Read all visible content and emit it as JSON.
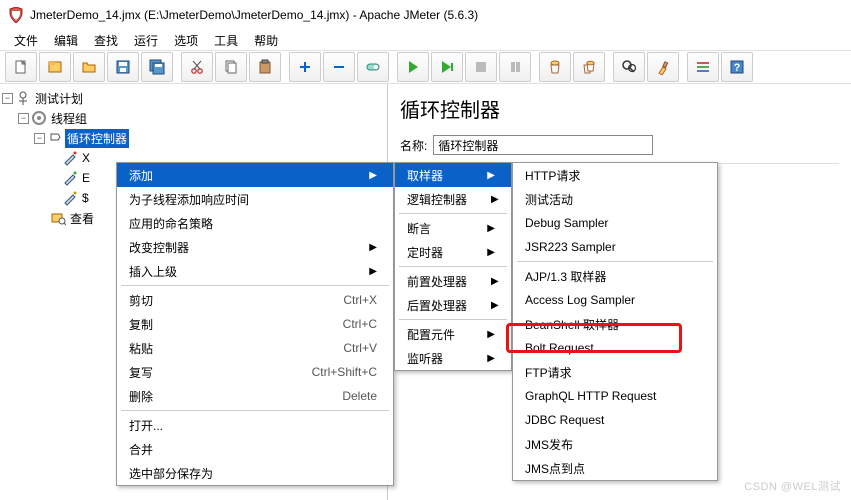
{
  "window": {
    "title": "JmeterDemo_14.jmx (E:\\JmeterDemo\\JmeterDemo_14.jmx) - Apache JMeter (5.6.3)"
  },
  "menubar": [
    "文件",
    "编辑",
    "查找",
    "运行",
    "选项",
    "工具",
    "帮助"
  ],
  "tree": {
    "root": "测试计划",
    "thread_group": "线程组",
    "loop_ctrl": "循环控制器",
    "child_prefix_1": "X",
    "child_prefix_2": "E",
    "child_prefix_3": "$",
    "view_results": "查看"
  },
  "panel": {
    "title": "循环控制器",
    "name_label": "名称:",
    "name_value": "循环控制器"
  },
  "menu1": {
    "add": "添加",
    "thread_response_time": "为子线程添加响应时间",
    "naming_policy": "应用的命名策略",
    "change_controller": "改变控制器",
    "insert_parent": "插入上级",
    "cut": "剪切",
    "cut_sc": "Ctrl+X",
    "copy": "复制",
    "copy_sc": "Ctrl+C",
    "paste": "粘贴",
    "paste_sc": "Ctrl+V",
    "duplicate": "复写",
    "duplicate_sc": "Ctrl+Shift+C",
    "delete": "删除",
    "delete_sc": "Delete",
    "open": "打开...",
    "merge": "合并",
    "save_selection": "选中部分保存为"
  },
  "menu2": {
    "sampler": "取样器",
    "logic": "逻辑控制器",
    "assertion": "断言",
    "timer": "定时器",
    "preproc": "前置处理器",
    "postproc": "后置处理器",
    "config": "配置元件",
    "listener": "监听器"
  },
  "menu3": {
    "http_request": "HTTP请求",
    "test_action": "测试活动",
    "debug_sampler": "Debug Sampler",
    "jsr223": "JSR223 Sampler",
    "ajp": "AJP/1.3 取样器",
    "access_log": "Access Log Sampler",
    "beanshell": "BeanShell 取样器",
    "bolt": "Bolt Request",
    "ftp": "FTP请求",
    "graphql": "GraphQL HTTP Request",
    "jdbc": "JDBC Request",
    "jms_pub": "JMS发布",
    "jms_p2p": "JMS点到点"
  },
  "watermark": "CSDN @WEL测试"
}
